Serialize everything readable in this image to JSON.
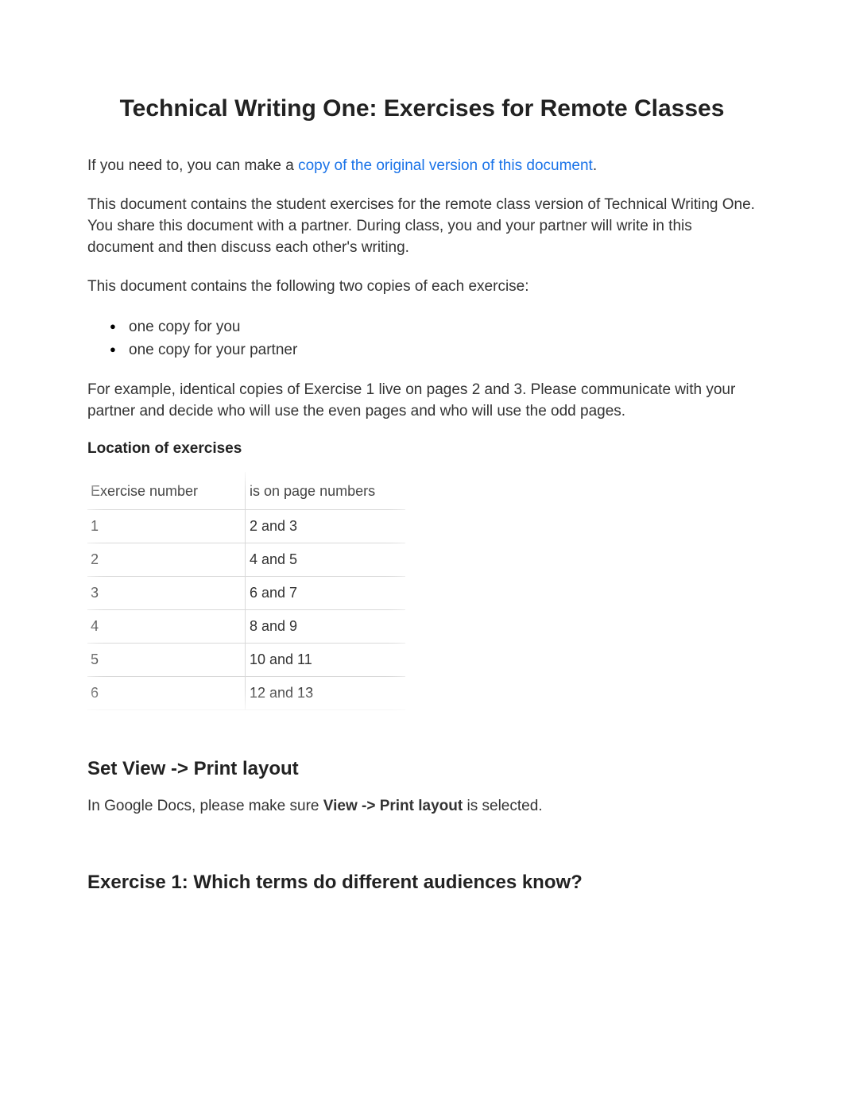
{
  "title": "Technical Writing One: Exercises for Remote Classes",
  "intro": {
    "prefix": "If you need to, you can make a ",
    "link_text": "copy of the original version of this document",
    "suffix": "."
  },
  "para_desc": "This document contains the student exercises for the remote class version of Technical Writing One. You share this document with a partner. During class, you and your partner will write in this document and then discuss each other's writing.",
  "para_copies": "This document contains the following two copies of each exercise:",
  "bullets": [
    "one copy for you",
    "one copy for your partner"
  ],
  "para_example": "For example, identical copies of Exercise 1 live on pages 2 and 3. Please communicate with your partner and decide who will use the even pages and who will use the odd pages.",
  "table": {
    "caption": "Location of exercises",
    "headers": [
      "Exercise number",
      "is on page numbers"
    ],
    "rows": [
      [
        "1",
        "2 and 3"
      ],
      [
        "2",
        "4 and 5"
      ],
      [
        "3",
        "6 and 7"
      ],
      [
        "4",
        "8 and 9"
      ],
      [
        "5",
        "10 and 11"
      ],
      [
        "6",
        "12 and 13"
      ]
    ]
  },
  "view_section": {
    "heading": "Set View -> Print layout",
    "text_prefix": "In Google Docs, please make sure ",
    "text_bold": "View -> Print layout",
    "text_suffix": " is selected."
  },
  "exercise1_heading": "Exercise 1: Which terms do different audiences know?"
}
